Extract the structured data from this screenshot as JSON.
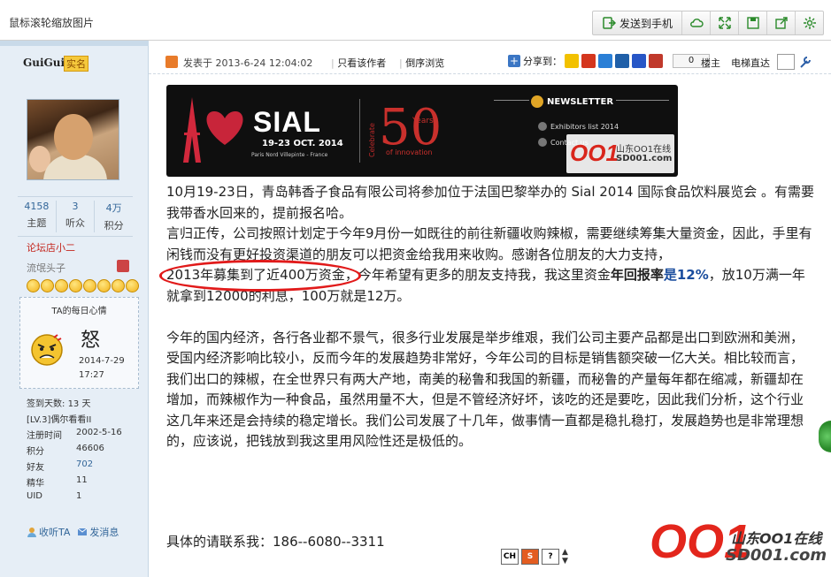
{
  "topbar": {
    "hint": "鼠标滚轮缩放图片",
    "send_to_phone": "发送到手机",
    "buttons": [
      "cloud-icon",
      "expand-icon",
      "save-icon",
      "share-icon",
      "settings-icon"
    ]
  },
  "sidebar": {
    "username": "GuiGui",
    "real_name_badge": "实名",
    "stats": [
      {
        "value": "4158",
        "label": "主题"
      },
      {
        "value": "3",
        "label": "听众"
      },
      {
        "value": "4万",
        "label": "积分"
      }
    ],
    "rank": "论坛店小二",
    "subrank": "流氓头子",
    "smiley_count": 8,
    "mood": {
      "title": "TA的每日心情",
      "word": "怒",
      "date": "2014-7-29",
      "time": "17:27"
    },
    "info": [
      {
        "k": "签到天数:",
        "v": "13 天",
        "link": false,
        "full": true
      },
      {
        "k": "[LV.3]偶尔看看II",
        "v": "",
        "link": false,
        "full": true
      },
      {
        "k": "注册时间",
        "v": "2002-5-16",
        "link": false
      },
      {
        "k": "积分",
        "v": "46606",
        "link": false
      },
      {
        "k": "好友",
        "v": "702",
        "link": true
      },
      {
        "k": "精华",
        "v": "11",
        "link": false
      },
      {
        "k": "UID",
        "v": "1",
        "link": false
      }
    ],
    "collect": "收听TA",
    "message": "发消息"
  },
  "post_header": {
    "posted_at": "发表于 2013-6-24 12:04:02",
    "only_author": "只看该作者",
    "reverse": "倒序浏览",
    "share_to": "分享到：",
    "share_count": "0",
    "floor": "楼主",
    "elevator": "电梯直达"
  },
  "banner": {
    "sial": "SIAL",
    "date": "19-23 OCT. 2014",
    "place": "Paris Nord Villepinte - France",
    "celebrate": "Celebrate",
    "fifty": "50",
    "years": "Years",
    "of_innovation": "of innovation",
    "newsletter": "NEWSLETTER",
    "exhibitors": "Exhibitors list 2014",
    "contact": "Contact us",
    "watermark_logo": "OO1",
    "watermark_cn": "山东OO1在线",
    "watermark_url": "SD001.com"
  },
  "content": {
    "p1": "10月19-23日，青岛韩香子食品有限公司将参加位于法国巴黎举办的 Sial 2014 国际食品饮料展览会 。有需要我带香水回来的，提前报名哈。",
    "p2_a": "言归正传，公司按照计划定于今年9月份一如既往的前往新疆收购辣椒，需要继续筹集大量资金，因此，手里有闲钱而没有更好投资渠道的朋友可以把资金给我用来收购。感谢各位朋友的大力支持，",
    "p2_hl": "2013年募集到了近400万资金",
    "p2_b": "，今年希望有更多的朋友支持我，我这里资金",
    "p2_bold": "年回报率",
    "p2_c_blue": "是12%",
    "p2_d": "，放10万满一年就拿到12000的利息，100万就是12万。",
    "p3": "今年的国内经济，各行各业都不景气，很多行业发展是举步维艰，我们公司主要产品都是出口到欧洲和美洲，受国内经济影响比较小，反而今年的发展趋势非常好，今年公司的目标是销售额突破一亿大关。相比较而言，我们出口的辣椒，在全世界只有两大产地，南美的秘鲁和我国的新疆，而秘鲁的产量每年都在缩减，新疆却在增加，而辣椒作为一种食品，虽然用量不大，但是不管经济好坏，该吃的还是要吃，因此我们分析，这个行业这几年来还是会持续的稳定增长。我们公司发展了十几年，做事情一直都是稳扎稳打，发展趋势也是非常理想的，应该说，把钱放到我这里用风险性还是极低的。",
    "contact": "具体的请联系我：186--6080--3311"
  },
  "mini_toolbar": {
    "ch": "CH",
    "s": "S",
    "q": "?"
  },
  "watermark": {
    "logo": "OO1",
    "cn": "山东OO1在线",
    "url": "SD001.com"
  },
  "colors": {
    "accent": "#336699",
    "red": "#e11a1a",
    "sidebar_bg": "#e6eef6"
  }
}
